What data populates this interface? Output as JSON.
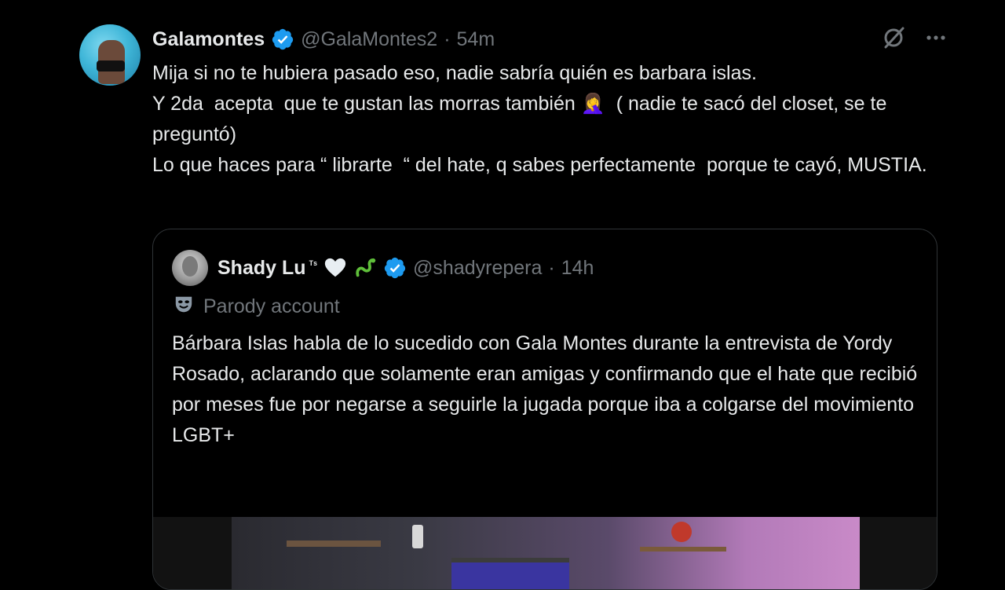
{
  "tweet": {
    "display_name": "Galamontes",
    "handle": "@GalaMontes2",
    "separator": "·",
    "time": "54m",
    "text": "Mija si no te hubiera pasado eso, nadie sabría quién es barbara islas.\nY 2da  acepta  que te gustan las morras también 🤦‍♀️  ( nadie te sacó del closet, se te preguntó)\nLo que haces para “ librarte  “ del hate, q sabes perfectamente  porque te cayó, MUSTIA."
  },
  "quote": {
    "display_name": "Shady Lu",
    "name_suffix": "ᵀˢ",
    "handle": "@shadyrepera",
    "separator": "·",
    "time": "14h",
    "parody_label": "Parody account",
    "text": "Bárbara Islas habla de lo sucedido con Gala Montes durante la entrevista de Yordy Rosado, aclarando que solamente eran amigas y confirmando que el hate que recibió por meses fue por negarse a seguirle la jugada porque iba a colgarse del movimiento LGBT+"
  },
  "icons": {
    "verified": "verified-badge-icon",
    "grok": "grok-icon",
    "more": "more-options-icon",
    "heart": "white-heart-emoji",
    "snake": "green-snake-emoji",
    "parody": "theater-mask-icon"
  },
  "colors": {
    "background": "#000000",
    "text_primary": "#e7e9ea",
    "text_secondary": "#71767b",
    "verified_blue": "#1d9bf0",
    "border": "#2f3336"
  }
}
